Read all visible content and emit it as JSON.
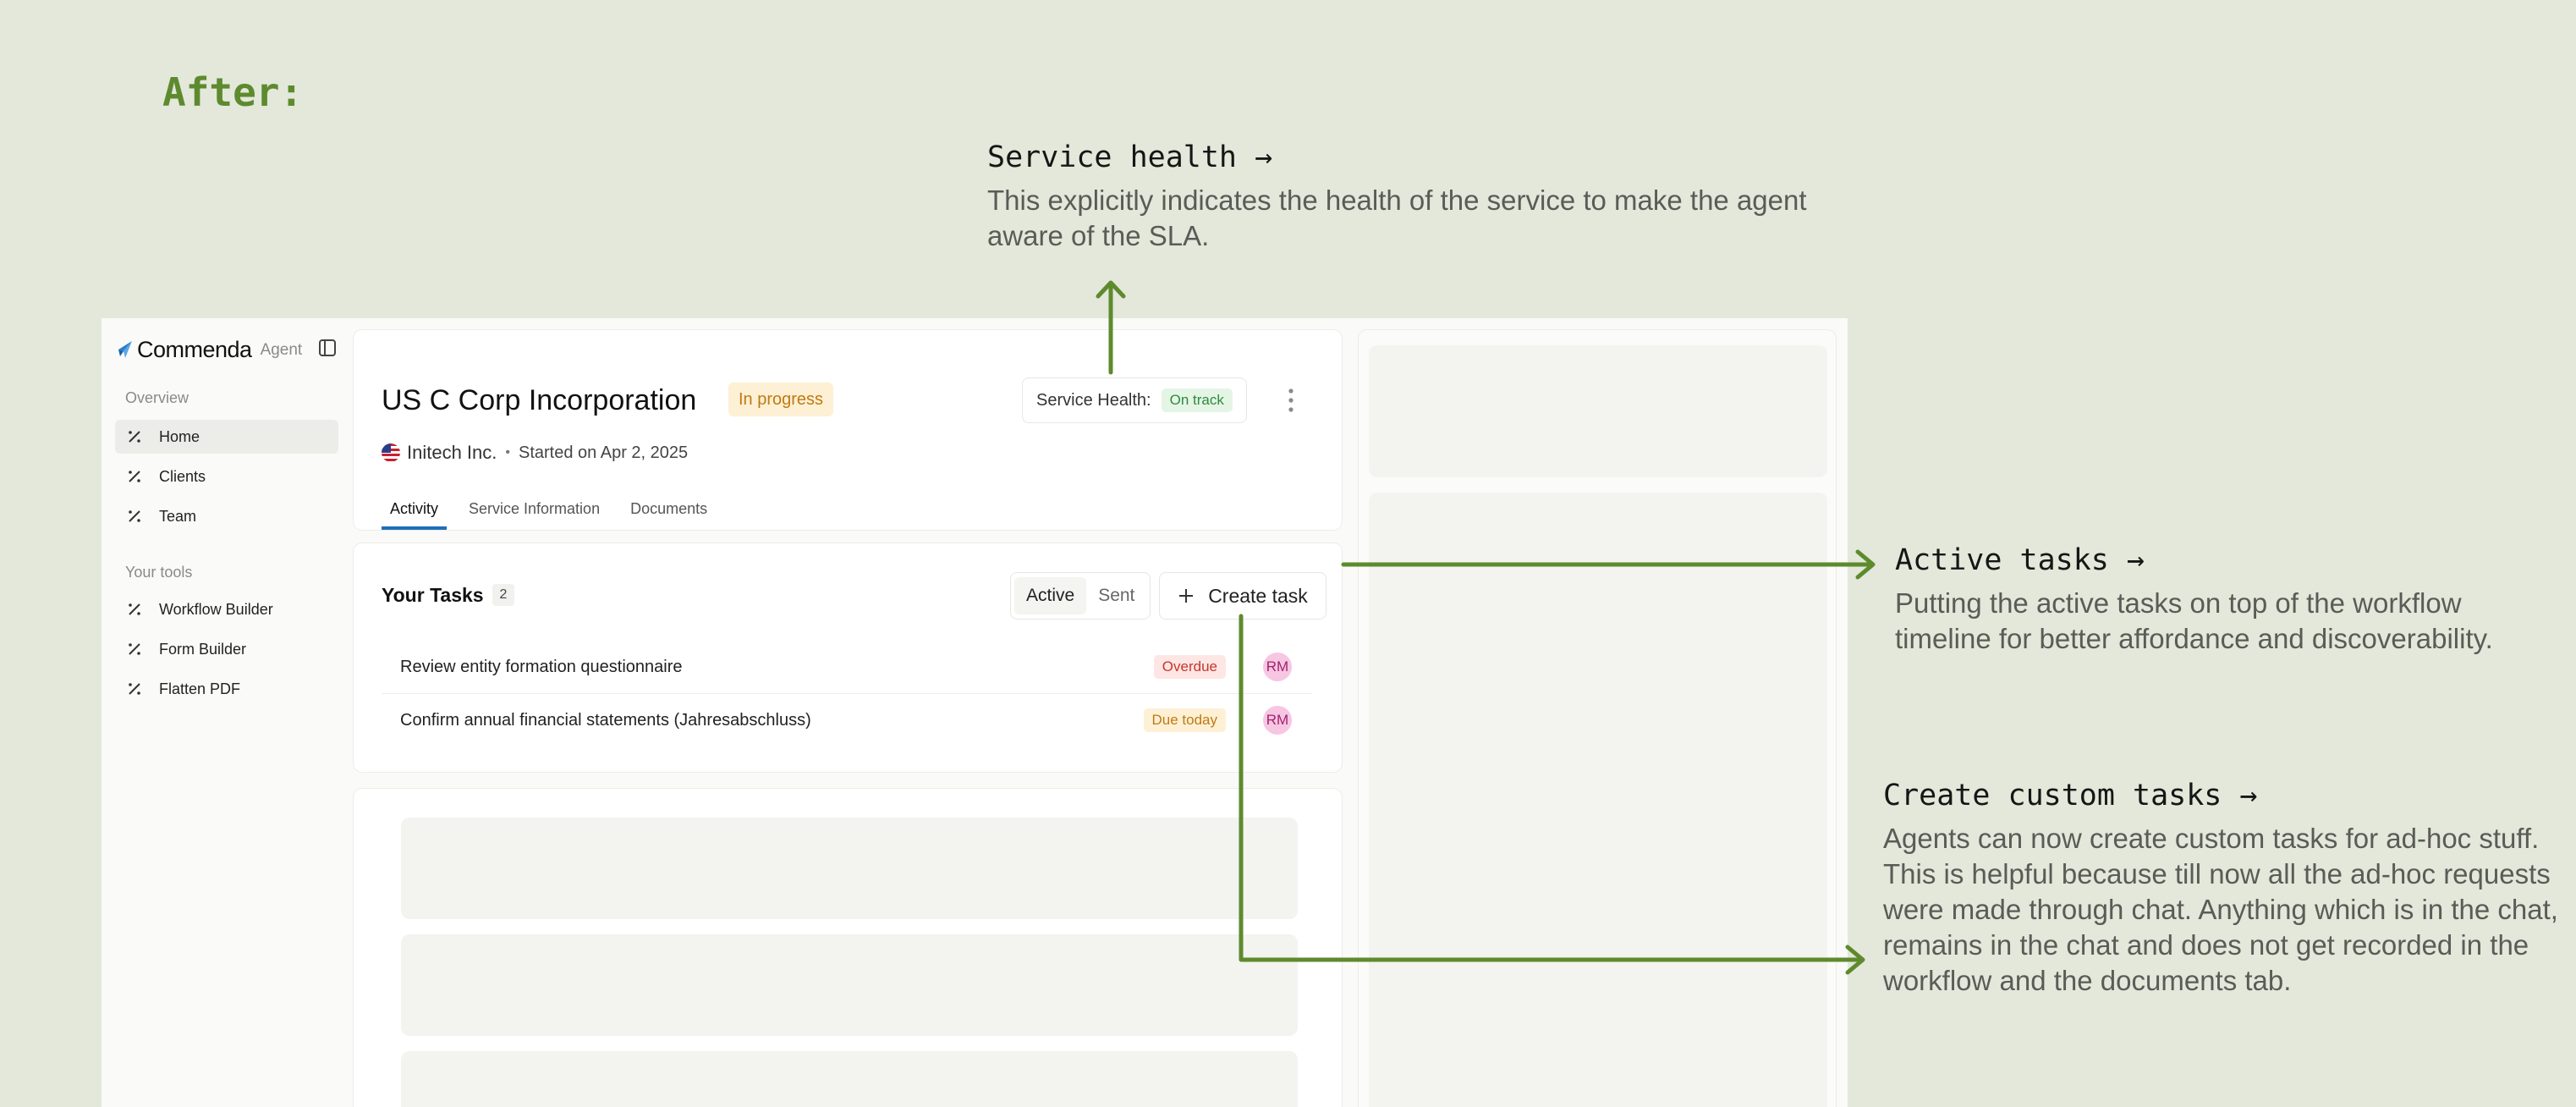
{
  "page": {
    "heading": "After:"
  },
  "annotations": {
    "health": {
      "title": "Service health →",
      "text": "This explicitly indicates the health of the service to make the agent aware of the SLA."
    },
    "tasks": {
      "title": "Active tasks →",
      "text": "Putting the active tasks on top of the workflow timeline for better affordance and discoverability."
    },
    "custom": {
      "title": "Create custom tasks →",
      "text": "Agents can now create custom tasks for ad-hoc stuff. This is helpful because till now all the ad-hoc requests were made through chat. Anything which is in the chat, remains in the chat and does not get recorded in the workflow and the documents tab."
    }
  },
  "colors": {
    "accent": "#5e8a2e",
    "arrow": "#5e8a2e",
    "tab_active": "#1e6fb8"
  },
  "sidebar": {
    "brand": "Commenda",
    "role": "Agent",
    "overview_label": "Overview",
    "overview_items": [
      {
        "label": "Home",
        "icon": "percent-icon",
        "active": true
      },
      {
        "label": "Clients",
        "icon": "percent-icon"
      },
      {
        "label": "Team",
        "icon": "percent-icon"
      }
    ],
    "tools_label": "Your tools",
    "tools_items": [
      {
        "label": "Workflow Builder",
        "icon": "percent-icon"
      },
      {
        "label": "Form Builder",
        "icon": "percent-icon"
      },
      {
        "label": "Flatten PDF",
        "icon": "percent-icon"
      }
    ]
  },
  "header": {
    "title": "US C Corp Incorporation",
    "status": "In progress",
    "health_label": "Service Health:",
    "health_status": "On track",
    "client": "Initech Inc.",
    "started": "Started on Apr 2, 2025",
    "tabs": [
      "Activity",
      "Service Information",
      "Documents"
    ]
  },
  "tasks": {
    "title": "Your Tasks",
    "count": "2",
    "filters": [
      "Active",
      "Sent"
    ],
    "create_label": "Create task",
    "items": [
      {
        "name": "Review entity formation questionnaire",
        "status": "Overdue",
        "assignee": "RM"
      },
      {
        "name": "Confirm annual financial statements (Jahresabschluss)",
        "status": "Due today",
        "assignee": "RM"
      }
    ]
  }
}
